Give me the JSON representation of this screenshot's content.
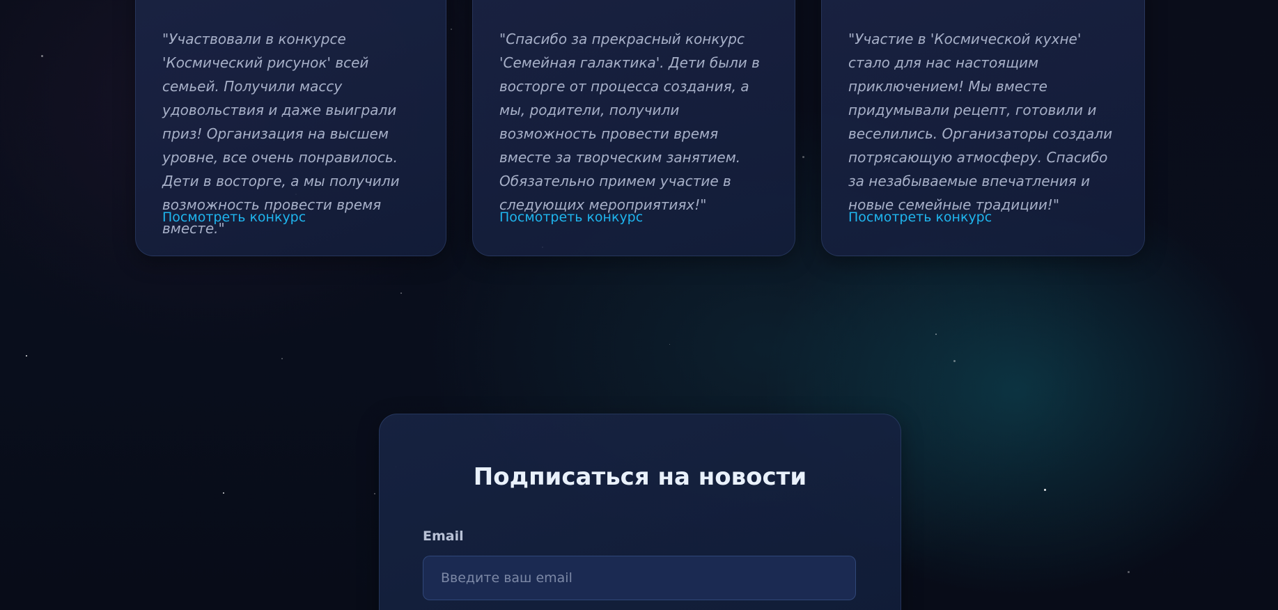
{
  "testimonials": [
    {
      "quote": "\"Участвовали в конкурсе 'Космический рисунок' всей семьей. Получили массу удовольствия и даже выиграли приз! Организация на высшем уровне, все очень понравилось. Дети в восторге, а мы получили возможность провести время вместе.\"",
      "link_label": "Посмотреть конкурс"
    },
    {
      "quote": "\"Спасибо за прекрасный конкурс 'Семейная галактика'. Дети были в восторге от процесса создания, а мы, родители, получили возможность провести время вместе за творческим занятием. Обязательно примем участие в следующих мероприятиях!\"",
      "link_label": "Посмотреть конкурс"
    },
    {
      "quote": "\"Участие в 'Космической кухне' стало для нас настоящим приключением! Мы вместе придумывали рецепт, готовили и веселились. Организаторы создали потрясающую атмосферу. Спасибо за незабываемые впечатления и новые семейные традиции!\"",
      "link_label": "Посмотреть конкурс"
    }
  ],
  "subscribe": {
    "title": "Подписаться на новости",
    "email_label": "Email",
    "email_placeholder": "Введите ваш email",
    "email_value": ""
  },
  "colors": {
    "accent_link": "#1fb5ee",
    "avatar": "#1f8fd0",
    "background": "#0a0d1a"
  }
}
